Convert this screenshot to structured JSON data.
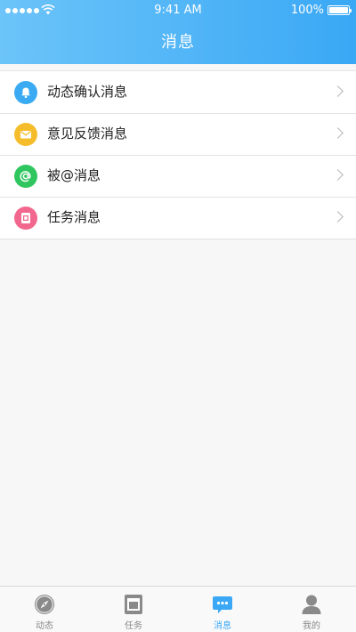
{
  "status_bar": {
    "time": "9:41 AM",
    "battery": "100%"
  },
  "header": {
    "title": "消息"
  },
  "list": {
    "items": [
      {
        "label": "动态确认消息",
        "icon": "bell-icon",
        "color": "#3aaaf2"
      },
      {
        "label": "意见反馈消息",
        "icon": "mail-icon",
        "color": "#f5bd2c"
      },
      {
        "label": "被@消息",
        "icon": "at-icon",
        "color": "#2fc65f"
      },
      {
        "label": "任务消息",
        "icon": "task-icon",
        "color": "#f2678d"
      }
    ]
  },
  "tabbar": {
    "tabs": [
      {
        "label": "动态",
        "icon": "compass-icon"
      },
      {
        "label": "任务",
        "icon": "task-icon"
      },
      {
        "label": "消息",
        "icon": "chat-bubble-icon",
        "active": true
      },
      {
        "label": "我的",
        "icon": "user-icon"
      }
    ],
    "active_color": "#3aa8f5"
  }
}
